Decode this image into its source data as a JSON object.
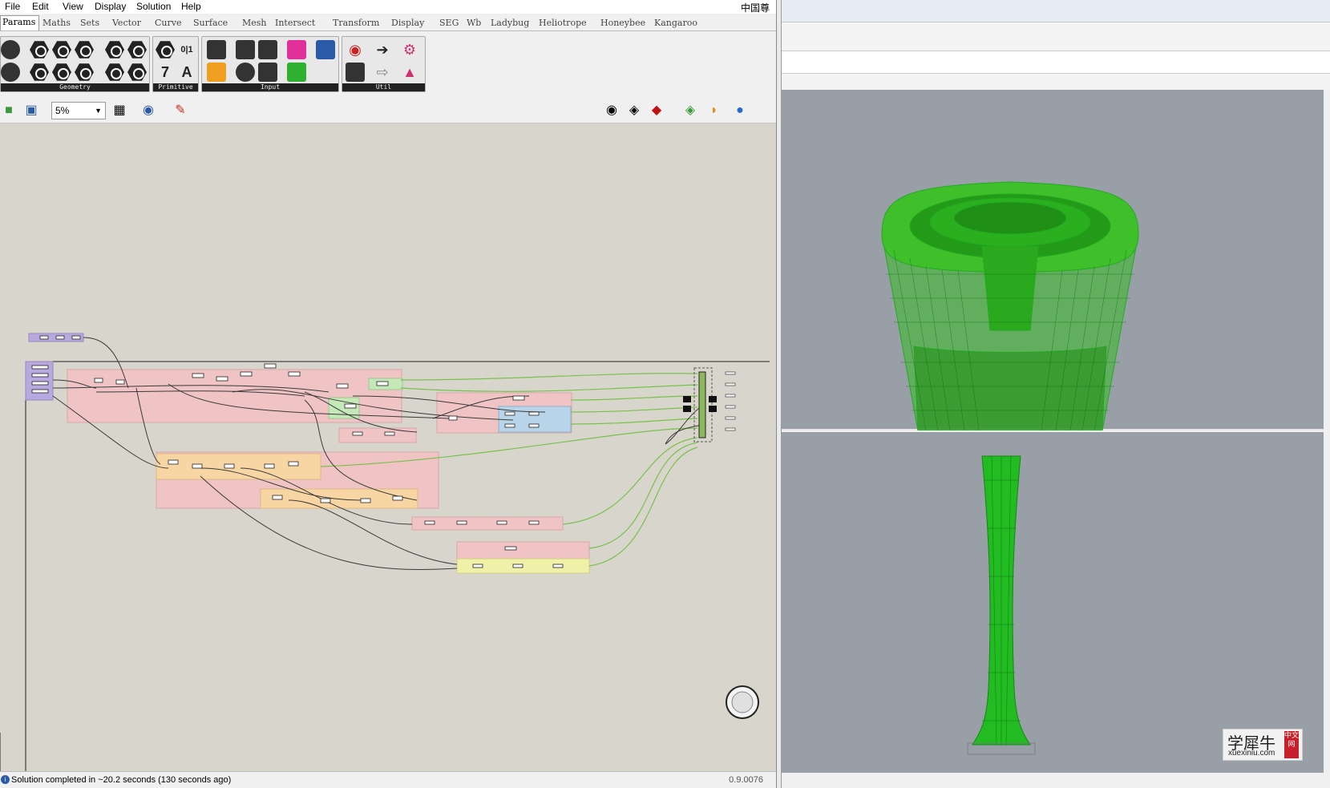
{
  "menu": {
    "items": [
      "File",
      "Edit",
      "View",
      "Display",
      "Solution",
      "Help"
    ],
    "right_label": "中国尊"
  },
  "tabs": [
    "Params",
    "Maths",
    "Sets",
    "Vector",
    "Curve",
    "Surface",
    "Mesh",
    "Intersect",
    "Transform",
    "Display",
    "SEG",
    "Wb",
    "Ladybug",
    "Heliotrope",
    "Honeybee",
    "Kangaroo"
  ],
  "ribbon": {
    "panels": [
      "Geometry",
      "Primitive",
      "Input",
      "Util"
    ],
    "primitive_icon_labels": [
      "0|1",
      "7",
      "A"
    ]
  },
  "toolbar": {
    "zoom": "5%"
  },
  "status": {
    "message": "Solution completed in ~20.2 seconds (130 seconds ago)",
    "version": "0.9.0076"
  },
  "viewport": {
    "watermark_text": "学犀牛",
    "watermark_url": "xuexiniu.com",
    "watermark_seal": "中文网",
    "mesh_color": "#22aa22"
  },
  "colors": {
    "group_pink": "#f0c4c4",
    "group_orange": "#f7d6a4",
    "group_green": "#c4e8b8",
    "group_blue": "#b8d4e8",
    "group_yellow": "#f0f0a8",
    "group_purple": "#b8a8e0",
    "wire_green": "#77c24a"
  }
}
